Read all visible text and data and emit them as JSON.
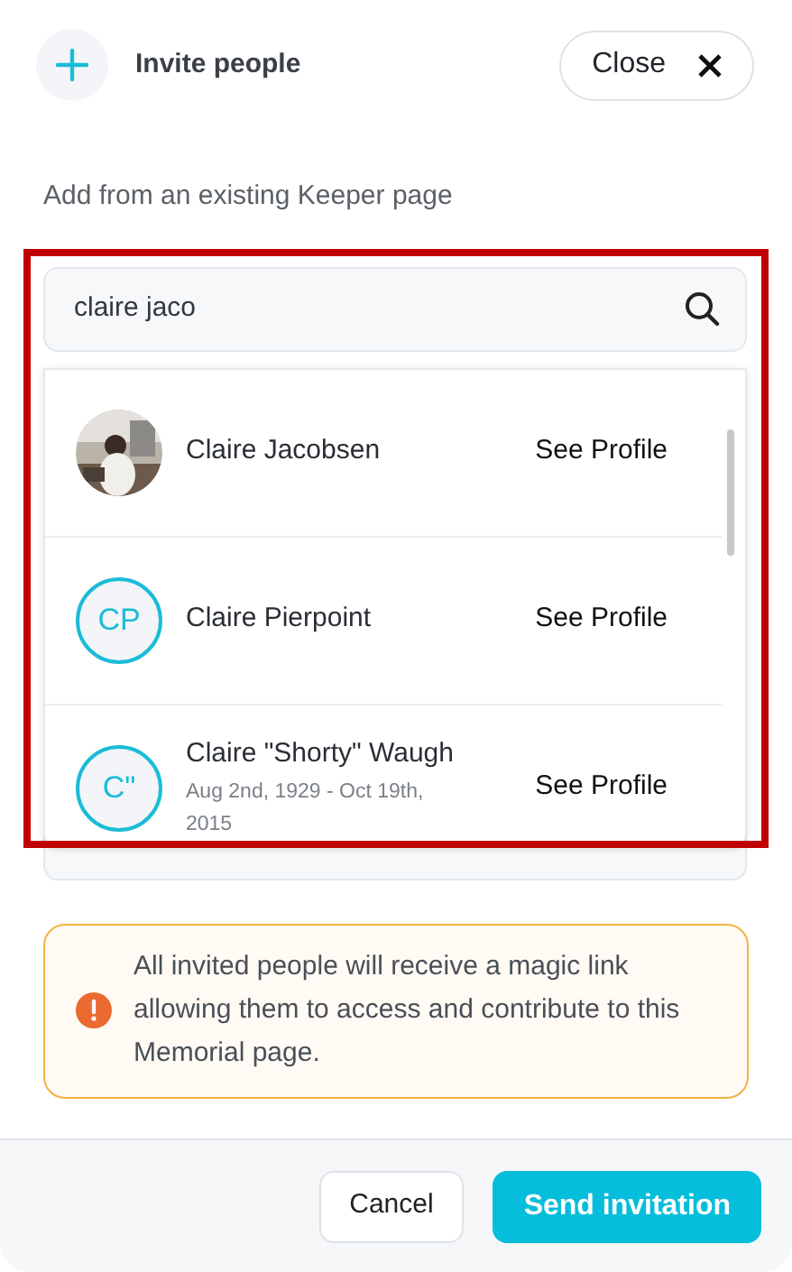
{
  "header": {
    "title": "Invite people",
    "close_label": "Close"
  },
  "section_label": "Add from an existing Keeper page",
  "search": {
    "value": "claire jaco"
  },
  "results": [
    {
      "name": "Claire Jacobsen",
      "action": "See Profile"
    },
    {
      "kind": "initials",
      "initials": "CP",
      "name": "Claire Pierpoint",
      "action": "See Profile"
    },
    {
      "kind": "initials",
      "initials": "C\"",
      "name": "Claire \"Shorty\" Waugh",
      "dates": "Aug 2nd, 1929 - Oct 19th, 2015",
      "action": "See Profile"
    }
  ],
  "notice": "All invited people will receive a magic link allowing them to access and contribute to this Memorial page.",
  "footer": {
    "cancel": "Cancel",
    "submit": "Send invitation"
  }
}
